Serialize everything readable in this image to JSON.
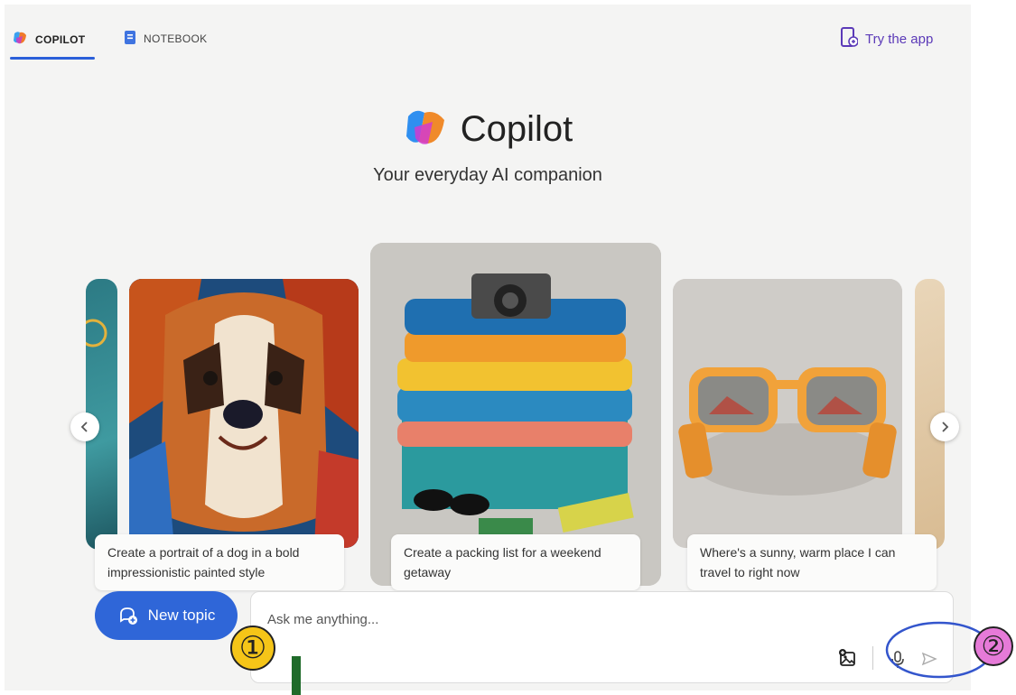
{
  "tabs": [
    {
      "label": "COPILOT",
      "active": true
    },
    {
      "label": "NOTEBOOK",
      "active": false
    }
  ],
  "try_app_label": "Try the app",
  "hero": {
    "brand": "Copilot",
    "tagline": "Your everyday AI companion"
  },
  "cards": [
    {
      "caption": "Create a portrait of a dog in a bold impressionistic painted style",
      "image": "impressionistic-dog-painting"
    },
    {
      "caption": "Create a packing list for a weekend getaway",
      "image": "folded-clothes-and-camera"
    },
    {
      "caption": "Where's a sunny, warm place I can travel to right now",
      "image": "orange-sunglasses"
    }
  ],
  "new_topic_label": "New topic",
  "compose": {
    "placeholder": "Ask me anything..."
  },
  "annotations": [
    "①",
    "②"
  ],
  "colors": {
    "accent": "#2f66d8",
    "try_app": "#5b3ab8",
    "annotation_fill": "#f5c518",
    "annotation2_fill": "#e67ad8",
    "annotation_line": "#1f6b2a"
  },
  "icons": [
    "copilot-logo-icon",
    "notebook-icon",
    "phone-app-icon",
    "chevron-left-icon",
    "chevron-right-icon",
    "chat-plus-icon",
    "image-add-icon",
    "microphone-icon",
    "send-icon"
  ]
}
